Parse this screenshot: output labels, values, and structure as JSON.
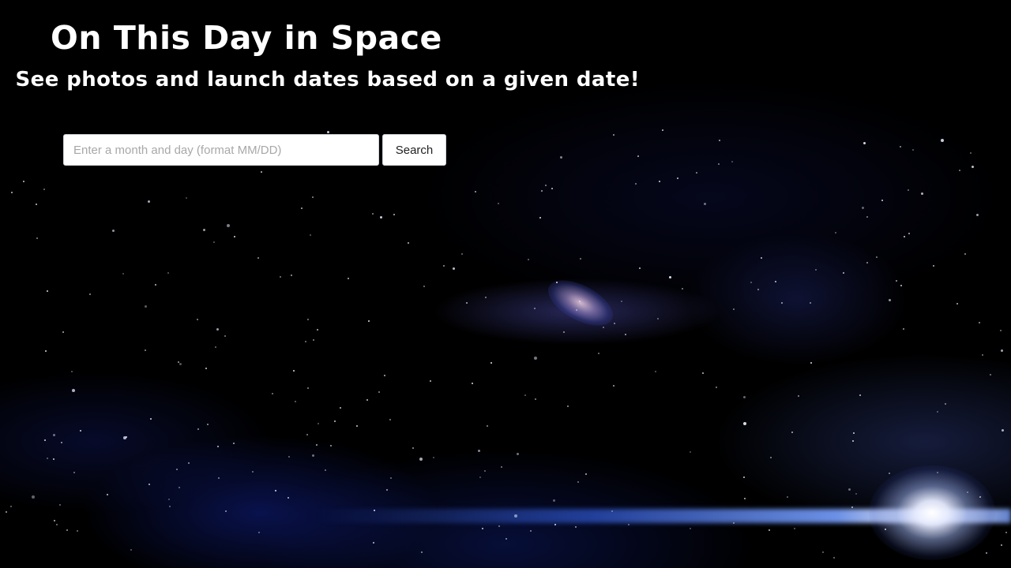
{
  "header": {
    "title": "On This Day in Space",
    "subtitle": "See photos and launch dates based on a given date!"
  },
  "search": {
    "placeholder": "Enter a month and day (format MM/DD)",
    "value": "",
    "button_label": "Search"
  },
  "colors": {
    "background": "#000000",
    "text": "#ffffff",
    "nebula_blue": "#2a46c8",
    "input_background": "#ffffff"
  }
}
